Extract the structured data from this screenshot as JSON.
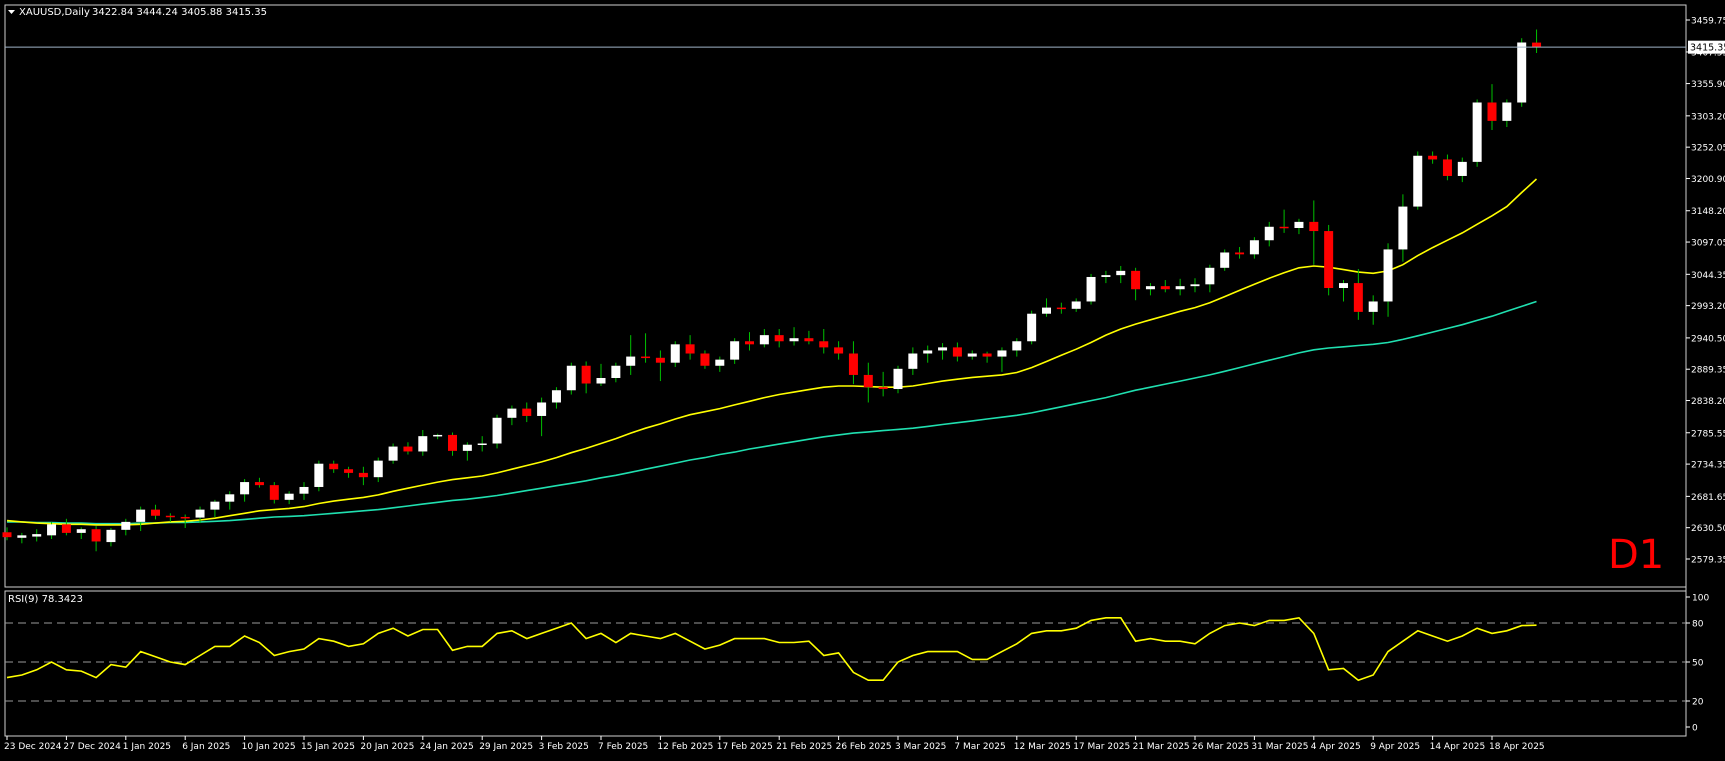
{
  "header": {
    "symbol": "XAUUSD,Daily",
    "ohlc": "3422.84 3444.24 3405.88 3415.35"
  },
  "timeframe_badge": "D1",
  "current_price_label": "3415.35",
  "colors": {
    "background": "#000000",
    "bull_candle": "#ffffff",
    "bear_candle": "#ff0000",
    "wick": "#00c000",
    "ma_fast": "#ffff00",
    "ma_slow": "#20e0b0",
    "rsi_line": "#ffff00",
    "badge": "#ff0000",
    "axis_text": "#ffffff",
    "price_line": "#a0b4c8"
  },
  "chart_data": [
    {
      "type": "candlestick",
      "title": "XAUUSD,Daily",
      "y_ticks": [
        "3459.75",
        "3407.55",
        "3355.90",
        "3303.20",
        "3252.05",
        "3200.90",
        "3148.20",
        "3097.05",
        "3044.35",
        "2993.20",
        "2940.50",
        "2889.35",
        "2838.20",
        "2785.55",
        "2734.35",
        "2681.65",
        "2630.50",
        "2579.35"
      ],
      "ylim": [
        2579.35,
        3459.75
      ],
      "x_ticks": [
        "23 Dec 2024",
        "27 Dec 2024",
        "1 Jan 2025",
        "6 Jan 2025",
        "10 Jan 2025",
        "15 Jan 2025",
        "20 Jan 2025",
        "24 Jan 2025",
        "29 Jan 2025",
        "3 Feb 2025",
        "7 Feb 2025",
        "12 Feb 2025",
        "17 Feb 2025",
        "21 Feb 2025",
        "26 Feb 2025",
        "3 Mar 2025",
        "7 Mar 2025",
        "12 Mar 2025",
        "17 Mar 2025",
        "21 Mar 2025",
        "26 Mar 2025",
        "31 Mar 2025",
        "4 Apr 2025",
        "9 Apr 2025",
        "14 Apr 2025",
        "18 Apr 2025"
      ],
      "x_tick_index": [
        0,
        4,
        8,
        12,
        16,
        20,
        24,
        28,
        32,
        36,
        40,
        44,
        48,
        52,
        56,
        60,
        64,
        68,
        72,
        76,
        80,
        84,
        88,
        92,
        96,
        100
      ],
      "ohlc": [
        [
          2623,
          2631,
          2610,
          2615
        ],
        [
          2614,
          2622,
          2605,
          2618
        ],
        [
          2616,
          2628,
          2608,
          2620
        ],
        [
          2618,
          2640,
          2612,
          2636
        ],
        [
          2636,
          2645,
          2618,
          2622
        ],
        [
          2622,
          2631,
          2612,
          2628
        ],
        [
          2628,
          2633,
          2592,
          2608
        ],
        [
          2607,
          2630,
          2600,
          2627
        ],
        [
          2627,
          2645,
          2618,
          2640
        ],
        [
          2640,
          2665,
          2625,
          2660
        ],
        [
          2660,
          2668,
          2644,
          2650
        ],
        [
          2650,
          2654,
          2640,
          2648
        ],
        [
          2648,
          2652,
          2630,
          2647
        ],
        [
          2647,
          2665,
          2638,
          2660
        ],
        [
          2660,
          2676,
          2648,
          2673
        ],
        [
          2673,
          2690,
          2660,
          2685
        ],
        [
          2685,
          2710,
          2673,
          2705
        ],
        [
          2705,
          2712,
          2696,
          2700
        ],
        [
          2700,
          2705,
          2670,
          2676
        ],
        [
          2676,
          2690,
          2669,
          2686
        ],
        [
          2686,
          2705,
          2676,
          2697
        ],
        [
          2697,
          2740,
          2690,
          2735
        ],
        [
          2735,
          2740,
          2720,
          2726
        ],
        [
          2726,
          2730,
          2712,
          2720
        ],
        [
          2720,
          2730,
          2700,
          2713
        ],
        [
          2713,
          2745,
          2705,
          2740
        ],
        [
          2740,
          2768,
          2735,
          2763
        ],
        [
          2763,
          2770,
          2750,
          2755
        ],
        [
          2755,
          2790,
          2748,
          2780
        ],
        [
          2780,
          2784,
          2775,
          2782
        ],
        [
          2782,
          2786,
          2748,
          2756
        ],
        [
          2756,
          2770,
          2740,
          2766
        ],
        [
          2766,
          2780,
          2755,
          2768
        ],
        [
          2768,
          2815,
          2760,
          2810
        ],
        [
          2810,
          2830,
          2798,
          2825
        ],
        [
          2825,
          2835,
          2803,
          2813
        ],
        [
          2813,
          2843,
          2780,
          2835
        ],
        [
          2835,
          2860,
          2825,
          2855
        ],
        [
          2855,
          2900,
          2848,
          2895
        ],
        [
          2895,
          2902,
          2850,
          2866
        ],
        [
          2866,
          2898,
          2862,
          2875
        ],
        [
          2875,
          2900,
          2868,
          2895
        ],
        [
          2895,
          2945,
          2880,
          2910
        ],
        [
          2910,
          2948,
          2900,
          2908
        ],
        [
          2908,
          2920,
          2870,
          2900
        ],
        [
          2900,
          2935,
          2893,
          2930
        ],
        [
          2930,
          2945,
          2905,
          2915
        ],
        [
          2915,
          2920,
          2890,
          2895
        ],
        [
          2895,
          2910,
          2885,
          2905
        ],
        [
          2905,
          2940,
          2898,
          2935
        ],
        [
          2935,
          2950,
          2920,
          2930
        ],
        [
          2930,
          2955,
          2925,
          2945
        ],
        [
          2945,
          2955,
          2925,
          2935
        ],
        [
          2935,
          2958,
          2928,
          2940
        ],
        [
          2940,
          2952,
          2930,
          2935
        ],
        [
          2935,
          2955,
          2915,
          2925
        ],
        [
          2925,
          2935,
          2905,
          2915
        ],
        [
          2915,
          2935,
          2865,
          2880
        ],
        [
          2880,
          2900,
          2835,
          2860
        ],
        [
          2860,
          2885,
          2845,
          2857
        ],
        [
          2857,
          2895,
          2850,
          2890
        ],
        [
          2890,
          2925,
          2880,
          2915
        ],
        [
          2915,
          2928,
          2900,
          2920
        ],
        [
          2920,
          2932,
          2905,
          2925
        ],
        [
          2925,
          2933,
          2902,
          2910
        ],
        [
          2910,
          2920,
          2905,
          2915
        ],
        [
          2915,
          2918,
          2900,
          2910
        ],
        [
          2910,
          2925,
          2885,
          2920
        ],
        [
          2920,
          2940,
          2910,
          2935
        ],
        [
          2935,
          2985,
          2930,
          2980
        ],
        [
          2980,
          3005,
          2975,
          2990
        ],
        [
          2990,
          2998,
          2980,
          2988
        ],
        [
          2988,
          3005,
          2983,
          3000
        ],
        [
          3000,
          3045,
          2995,
          3040
        ],
        [
          3040,
          3050,
          3030,
          3043
        ],
        [
          3043,
          3058,
          3030,
          3050
        ],
        [
          3050,
          3055,
          3002,
          3020
        ],
        [
          3020,
          3030,
          3010,
          3025
        ],
        [
          3025,
          3035,
          3015,
          3020
        ],
        [
          3020,
          3037,
          3010,
          3025
        ],
        [
          3025,
          3038,
          3015,
          3028
        ],
        [
          3028,
          3060,
          3015,
          3055
        ],
        [
          3055,
          3085,
          3050,
          3080
        ],
        [
          3080,
          3089,
          3070,
          3077
        ],
        [
          3077,
          3105,
          3070,
          3100
        ],
        [
          3100,
          3130,
          3090,
          3122
        ],
        [
          3122,
          3150,
          3112,
          3120
        ],
        [
          3120,
          3135,
          3110,
          3130
        ],
        [
          3130,
          3165,
          3060,
          3115
        ],
        [
          3115,
          3125,
          3010,
          3022
        ],
        [
          3022,
          3035,
          3000,
          3030
        ],
        [
          3030,
          3053,
          2970,
          2983
        ],
        [
          2983,
          3010,
          2962,
          3000
        ],
        [
          3000,
          3095,
          2975,
          3085
        ],
        [
          3085,
          3175,
          3065,
          3155
        ],
        [
          3155,
          3245,
          3150,
          3238
        ],
        [
          3238,
          3245,
          3225,
          3232
        ],
        [
          3232,
          3240,
          3198,
          3205
        ],
        [
          3205,
          3235,
          3195,
          3228
        ],
        [
          3228,
          3330,
          3220,
          3325
        ],
        [
          3325,
          3355,
          3280,
          3295
        ],
        [
          3295,
          3330,
          3285,
          3325
        ],
        [
          3325,
          3430,
          3318,
          3423
        ],
        [
          3422.84,
          3444.24,
          3405.88,
          3415.35
        ]
      ],
      "ma_fast": [
        2642,
        2640,
        2638,
        2637,
        2636,
        2636,
        2635,
        2635,
        2635,
        2636,
        2638,
        2640,
        2641,
        2643,
        2646,
        2650,
        2654,
        2658,
        2660,
        2662,
        2665,
        2670,
        2674,
        2677,
        2680,
        2684,
        2690,
        2695,
        2700,
        2705,
        2709,
        2712,
        2715,
        2720,
        2726,
        2732,
        2738,
        2745,
        2753,
        2760,
        2768,
        2776,
        2785,
        2793,
        2800,
        2808,
        2815,
        2820,
        2825,
        2831,
        2837,
        2843,
        2848,
        2852,
        2856,
        2860,
        2862,
        2862,
        2861,
        2860,
        2860,
        2862,
        2866,
        2870,
        2873,
        2876,
        2878,
        2880,
        2884,
        2892,
        2902,
        2912,
        2922,
        2933,
        2945,
        2955,
        2963,
        2970,
        2977,
        2984,
        2990,
        2998,
        3008,
        3018,
        3028,
        3038,
        3047,
        3055,
        3058,
        3056,
        3052,
        3048,
        3046,
        3050,
        3060,
        3075,
        3088,
        3100,
        3112,
        3126,
        3140,
        3155,
        3178,
        3200
      ],
      "ma_slow": [
        2640,
        2640,
        2639,
        2639,
        2638,
        2638,
        2637,
        2637,
        2637,
        2638,
        2638,
        2639,
        2639,
        2640,
        2641,
        2642,
        2644,
        2646,
        2648,
        2649,
        2650,
        2652,
        2654,
        2656,
        2658,
        2660,
        2663,
        2666,
        2669,
        2672,
        2675,
        2677,
        2680,
        2683,
        2687,
        2691,
        2695,
        2699,
        2703,
        2707,
        2712,
        2716,
        2721,
        2726,
        2731,
        2736,
        2741,
        2745,
        2750,
        2754,
        2759,
        2763,
        2767,
        2771,
        2775,
        2779,
        2782,
        2785,
        2787,
        2789,
        2791,
        2793,
        2796,
        2799,
        2802,
        2805,
        2808,
        2811,
        2814,
        2818,
        2823,
        2828,
        2833,
        2838,
        2843,
        2849,
        2855,
        2860,
        2865,
        2870,
        2875,
        2880,
        2886,
        2892,
        2898,
        2904,
        2910,
        2916,
        2921,
        2924,
        2926,
        2928,
        2930,
        2933,
        2938,
        2944,
        2950,
        2956,
        2962,
        2969,
        2976,
        2984,
        2992,
        3000
      ]
    },
    {
      "type": "line",
      "title": "RSI(9) 78.3423",
      "ylim": [
        0,
        100
      ],
      "y_ticks": [
        "100",
        "80",
        "50",
        "20",
        "0"
      ],
      "levels": [
        80,
        50,
        20
      ],
      "values": [
        38,
        40,
        44,
        50,
        44,
        43,
        38,
        48,
        46,
        58,
        54,
        50,
        48,
        55,
        62,
        62,
        70,
        65,
        55,
        58,
        60,
        68,
        66,
        62,
        64,
        72,
        76,
        70,
        75,
        75,
        59,
        62,
        62,
        72,
        74,
        68,
        72,
        76,
        80,
        68,
        72,
        65,
        72,
        70,
        68,
        72,
        66,
        60,
        63,
        68,
        68,
        68,
        65,
        65,
        66,
        55,
        57,
        42,
        36,
        36,
        50,
        55,
        58,
        58,
        58,
        52,
        52,
        58,
        64,
        72,
        74,
        74,
        76,
        82,
        84,
        84,
        66,
        68,
        66,
        66,
        64,
        72,
        78,
        80,
        78,
        82,
        82,
        84,
        72,
        44,
        45,
        36,
        40,
        58,
        66,
        74,
        70,
        66,
        70,
        76,
        72,
        74,
        78,
        78.34
      ]
    }
  ]
}
